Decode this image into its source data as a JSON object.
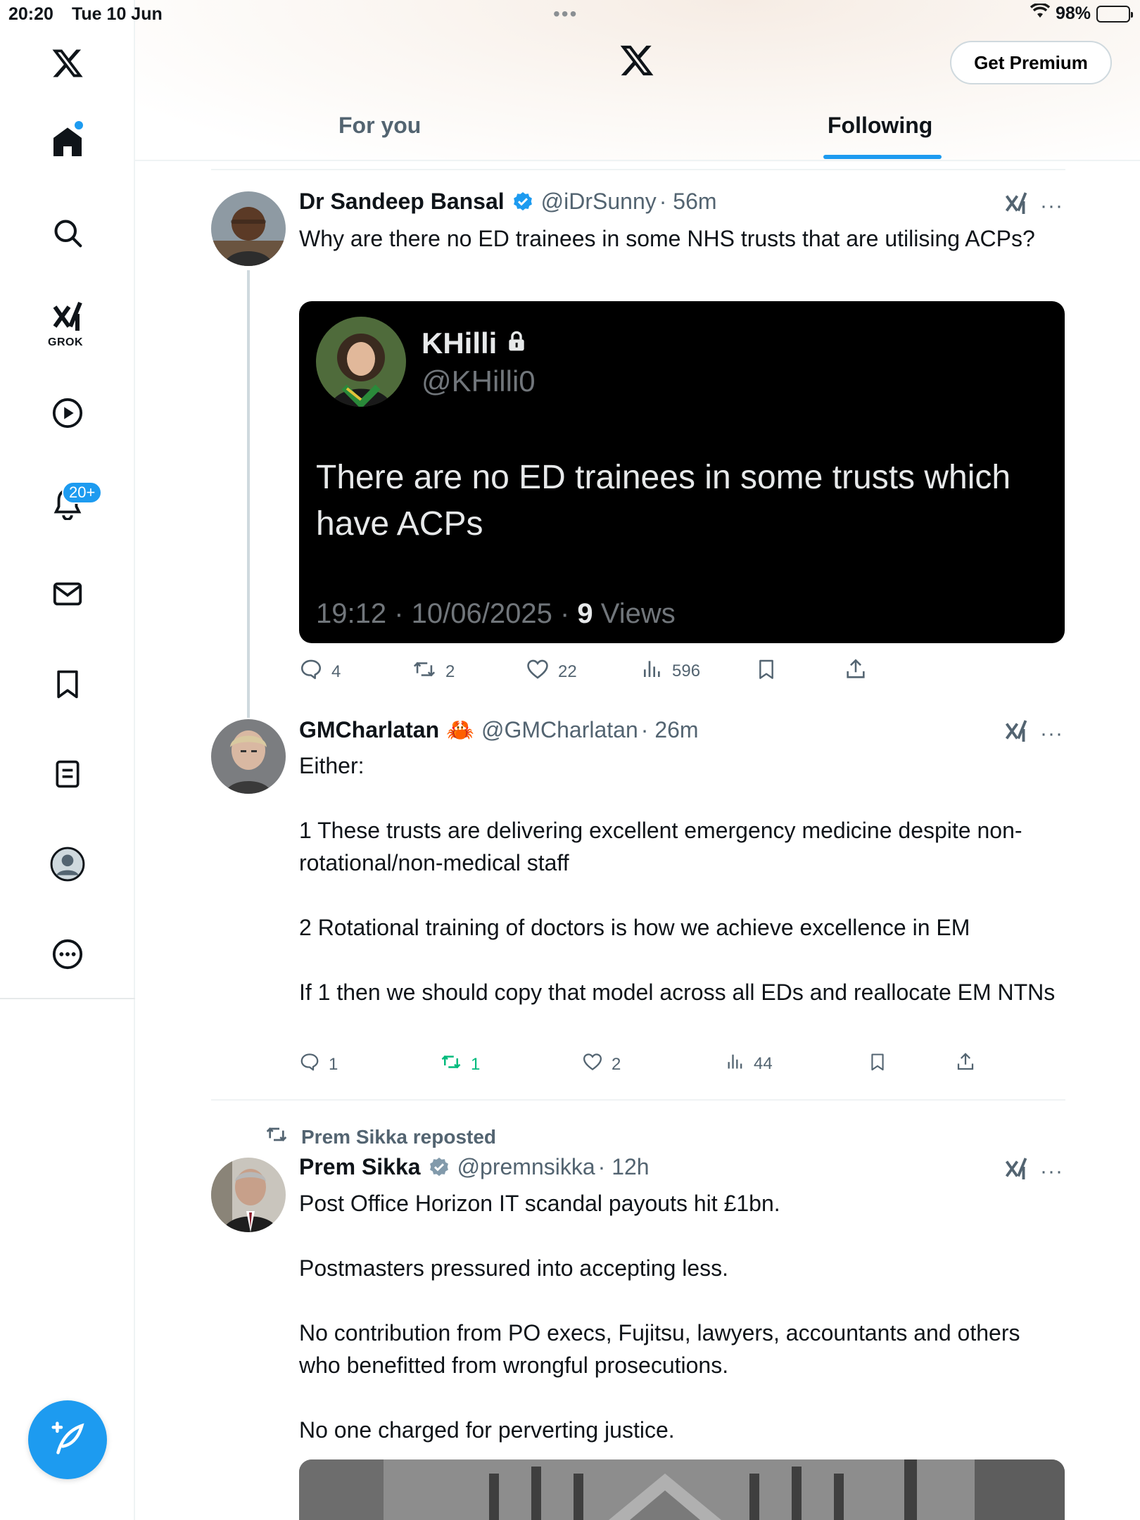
{
  "status_bar": {
    "time": "20:20",
    "date": "Tue 10 Jun",
    "dots": "•••",
    "battery": "98%"
  },
  "colors": {
    "accent": "#1d9bf0",
    "text": "#0f1419",
    "muted": "#536471",
    "repost_green": "#00ba7c"
  },
  "sidebar": {
    "items": [
      {
        "name": "x-logo",
        "icon": "x-logo-icon"
      },
      {
        "name": "home",
        "icon": "home-icon"
      },
      {
        "name": "search",
        "icon": "search-icon"
      },
      {
        "name": "grok",
        "icon": "grok-icon",
        "label": "GROK"
      },
      {
        "name": "video",
        "icon": "play-icon"
      },
      {
        "name": "notifications",
        "icon": "bell-icon",
        "badge": "20+"
      },
      {
        "name": "messages",
        "icon": "mail-icon"
      },
      {
        "name": "bookmarks",
        "icon": "bookmark-icon"
      },
      {
        "name": "lists",
        "icon": "list-icon"
      },
      {
        "name": "profile",
        "icon": "profile-icon"
      },
      {
        "name": "more",
        "icon": "more-icon"
      }
    ],
    "compose_icon": "compose-icon"
  },
  "header": {
    "premium_label": "Get Premium",
    "tabs": [
      {
        "label": "For you",
        "selected": false
      },
      {
        "label": "Following",
        "selected": true
      }
    ]
  },
  "feed": {
    "tweets": [
      {
        "name": "Dr Sandeep Bansal",
        "handle": "@iDrSunny",
        "time": "· 56m",
        "text": [
          "Why are there no ED trainees in some NHS trusts that are utilising ACPs?"
        ],
        "quote_image": {
          "name": "KHilli",
          "handle": "@KHilli0",
          "text": "There are no ED trainees in some trusts which have ACPs",
          "meta_time": "19:12 · 10/06/2025 · ",
          "meta_views_num": "9",
          "meta_views_label": " Views"
        },
        "actions": {
          "replies": "4",
          "reposts": "2",
          "likes": "22",
          "views": "596"
        }
      },
      {
        "name": "GMCharlatan",
        "emoji": "🦀",
        "handle": "@GMCharlatan",
        "time": "· 26m",
        "text": [
          "Either:",
          "",
          "1 These trusts are delivering excellent emergency medicine despite non-rotational/non-medical staff",
          "",
          "2 Rotational training of doctors is how we achieve excellence in EM",
          "",
          "If 1 then we should copy that model across all EDs and reallocate EM NTNs"
        ],
        "actions": {
          "replies": "1",
          "reposts": "1",
          "likes": "2",
          "views": "44"
        }
      },
      {
        "repost_label": "Prem Sikka reposted",
        "name": "Prem Sikka",
        "handle": "@premnsikka",
        "time": "· 12h",
        "text": [
          "Post Office Horizon IT scandal payouts hit £1bn.",
          "",
          "Postmasters pressured into accepting less.",
          "",
          "No contribution from PO execs, Fujitsu, lawyers, accountants and others who benefitted from wrongful prosecutions.",
          "",
          "No one charged for perverting justice."
        ]
      }
    ]
  }
}
